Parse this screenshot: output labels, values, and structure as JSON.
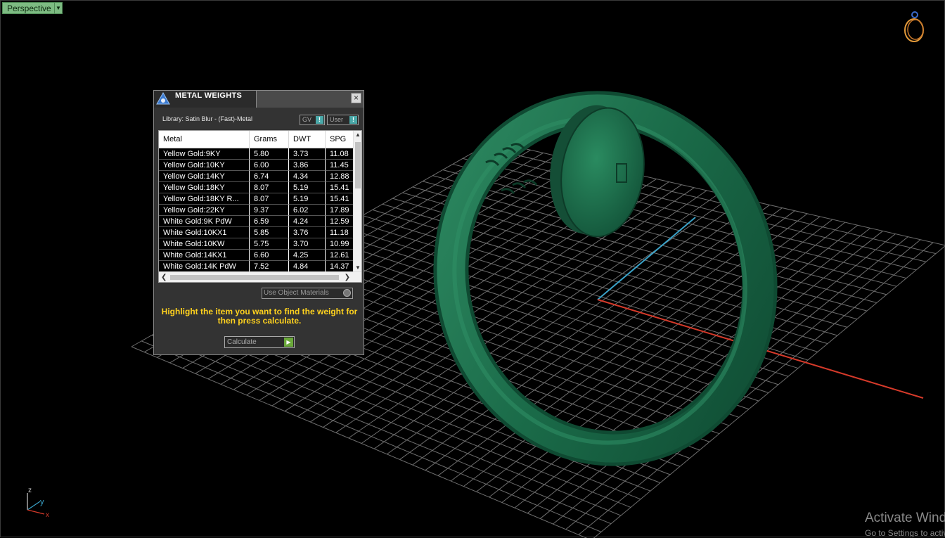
{
  "viewport": {
    "view_label": "Perspective",
    "view_dropdown_icon": "triangle-down-icon",
    "axis_labels": {
      "x": "x",
      "y": "y",
      "z": "z"
    },
    "axis_colors": {
      "x": "#d63a2a",
      "y": "#3aa3c9",
      "z": "#cfcfcf"
    },
    "object_color": "#1f6b4a",
    "grid_color": "#6e6e6e"
  },
  "panel": {
    "title": "METAL WEIGHTS",
    "close_icon": "close-icon",
    "library_label": "Library: Satin Blur - (Fast)-Metal",
    "gv_button": "GV",
    "user_button": "User",
    "table": {
      "headers": [
        "Metal",
        "Grams",
        "DWT",
        "SPG"
      ],
      "rows": [
        [
          "Yellow Gold:9KY",
          "5.80",
          "3.73",
          "11.08"
        ],
        [
          "Yellow Gold:10KY",
          "6.00",
          "3.86",
          "11.45"
        ],
        [
          "Yellow Gold:14KY",
          "6.74",
          "4.34",
          "12.88"
        ],
        [
          "Yellow Gold:18KY",
          "8.07",
          "5.19",
          "15.41"
        ],
        [
          "Yellow Gold:18KY R...",
          "8.07",
          "5.19",
          "15.41"
        ],
        [
          "Yellow Gold:22KY",
          "9.37",
          "6.02",
          "17.89"
        ],
        [
          "White Gold:9K PdW",
          "6.59",
          "4.24",
          "12.59"
        ],
        [
          "White Gold:10KX1",
          "5.85",
          "3.76",
          "11.18"
        ],
        [
          "White Gold:10KW",
          "5.75",
          "3.70",
          "10.99"
        ],
        [
          "White Gold:14KX1",
          "6.60",
          "4.25",
          "12.61"
        ],
        [
          "White Gold:14K PdW",
          "7.52",
          "4.84",
          "14.37"
        ]
      ]
    },
    "use_object_materials": "Use Object Materials",
    "hint": "Highlight the item you want to find the weight for then press calculate.",
    "calculate_button": "Calculate"
  },
  "watermark": {
    "title": "Activate Windows",
    "subtitle": "Go to Settings to activate Windows."
  }
}
